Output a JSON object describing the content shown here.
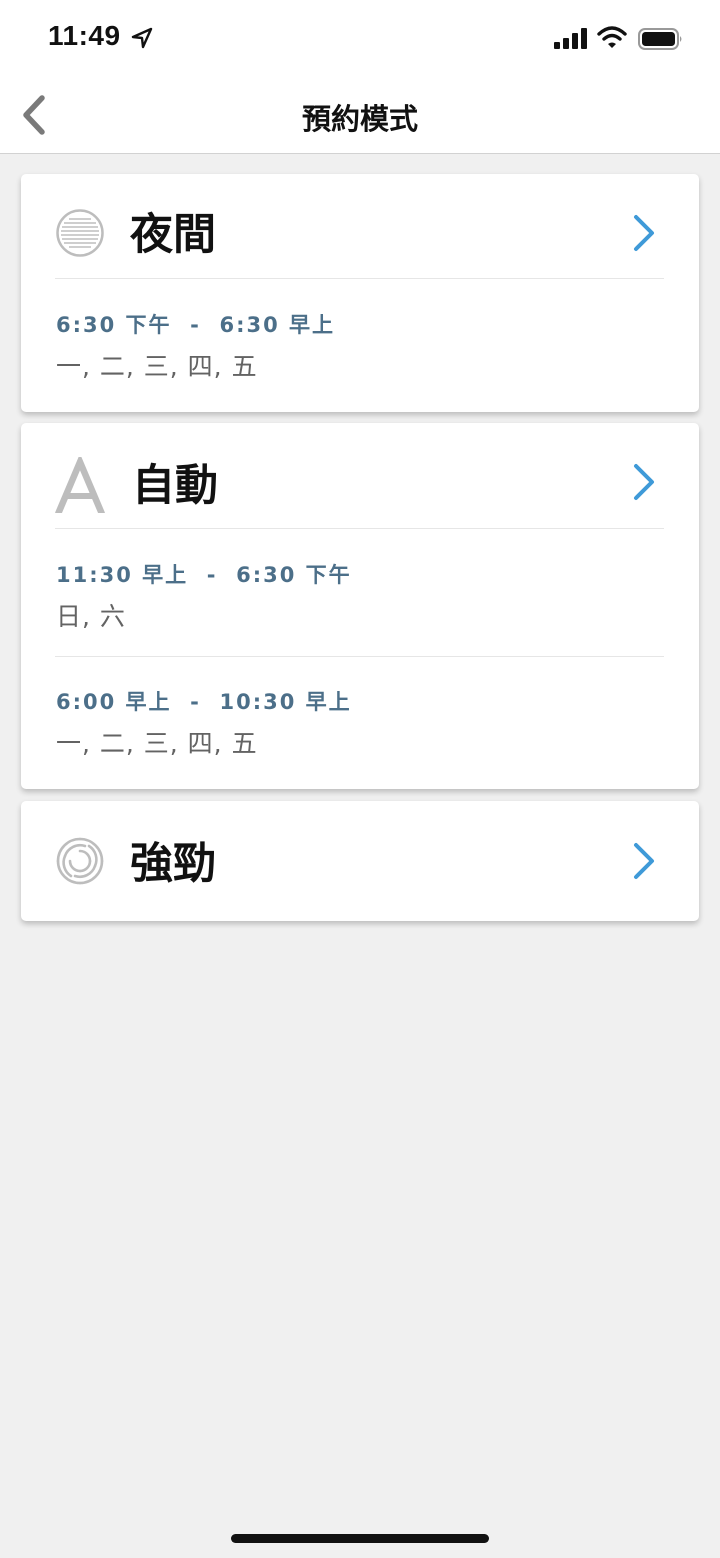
{
  "status_bar": {
    "time": "11:49"
  },
  "nav": {
    "title": "預約模式"
  },
  "modes": [
    {
      "name": "夜間",
      "icon": "night-mode-icon",
      "schedules": [
        {
          "time": "6:30 下午  -  6:30 早上",
          "days": "一, 二, 三, 四, 五"
        }
      ]
    },
    {
      "name": "自動",
      "icon": "auto-mode-icon",
      "schedules": [
        {
          "time": "11:30 早上  -  6:30 下午",
          "days": "日, 六"
        },
        {
          "time": "6:00 早上  -  10:30 早上",
          "days": "一, 二, 三, 四, 五"
        }
      ]
    },
    {
      "name": "強勁",
      "icon": "turbo-mode-icon",
      "schedules": []
    }
  ],
  "colors": {
    "accent": "#3f9ad8",
    "time_text": "#4c6f89",
    "icon_gray": "#bdbdbd"
  }
}
